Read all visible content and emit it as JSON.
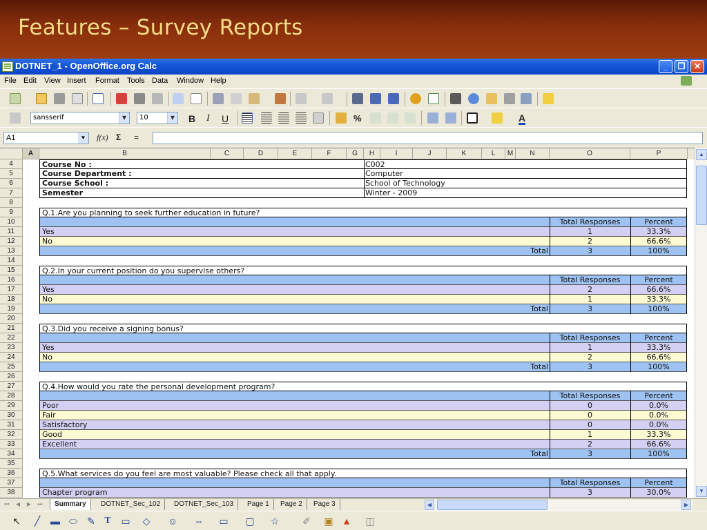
{
  "slide": {
    "title": "Features – Survey Reports"
  },
  "window": {
    "title": "DOTNET_1 - OpenOffice.org Calc"
  },
  "menu": [
    "File",
    "Edit",
    "View",
    "Insert",
    "Format",
    "Tools",
    "Data",
    "Window",
    "Help"
  ],
  "format_toolbar": {
    "font_name": "sansserif",
    "font_size": "10"
  },
  "formula_bar": {
    "cell_ref": "A1",
    "formula": "",
    "func_symbol": "f(x)",
    "sum_symbol": "Σ",
    "equals_symbol": "="
  },
  "columns": [
    "A",
    "B",
    "C",
    "D",
    "E",
    "F",
    "G",
    "H",
    "I",
    "J",
    "K",
    "L",
    "M",
    "N",
    "O",
    "P"
  ],
  "selected_column": "A",
  "rows": [
    {
      "n": "4",
      "type": "info",
      "label": "Course No :",
      "value": "C002"
    },
    {
      "n": "5",
      "type": "info",
      "label": "Course Department :",
      "value": "Computer"
    },
    {
      "n": "6",
      "type": "info",
      "label": "Course School :",
      "value": "School of Technology"
    },
    {
      "n": "7",
      "type": "info",
      "label": "Semester",
      "value": "Winter - 2009"
    },
    {
      "n": "8",
      "type": "blank"
    },
    {
      "n": "9",
      "type": "question",
      "label": "Q.1.Are you planning to seek further education in future?"
    },
    {
      "n": "10",
      "type": "header",
      "resp": "Total Responses",
      "pct": "Percent"
    },
    {
      "n": "11",
      "type": "answer",
      "shade": "purple",
      "label": "Yes",
      "resp": "1",
      "pct": "33.3%"
    },
    {
      "n": "12",
      "type": "answer",
      "shade": "yellow",
      "label": "No",
      "resp": "2",
      "pct": "66.6%"
    },
    {
      "n": "13",
      "type": "total",
      "label": "Total",
      "resp": "3",
      "pct": "100%"
    },
    {
      "n": "14",
      "type": "blank"
    },
    {
      "n": "15",
      "type": "question",
      "label": "Q.2.In your current position do you supervise others?"
    },
    {
      "n": "16",
      "type": "header",
      "resp": "Total Responses",
      "pct": "Percent"
    },
    {
      "n": "17",
      "type": "answer",
      "shade": "purple",
      "label": "Yes",
      "resp": "2",
      "pct": "66.6%"
    },
    {
      "n": "18",
      "type": "answer",
      "shade": "yellow",
      "label": "No",
      "resp": "1",
      "pct": "33.3%"
    },
    {
      "n": "19",
      "type": "total",
      "label": "Total",
      "resp": "3",
      "pct": "100%"
    },
    {
      "n": "20",
      "type": "blank"
    },
    {
      "n": "21",
      "type": "question",
      "label": "Q.3.Did you receive a signing bonus?"
    },
    {
      "n": "22",
      "type": "header",
      "resp": "Total Responses",
      "pct": "Percent"
    },
    {
      "n": "23",
      "type": "answer",
      "shade": "purple",
      "label": "Yes",
      "resp": "1",
      "pct": "33.3%"
    },
    {
      "n": "24",
      "type": "answer",
      "shade": "yellow",
      "label": "No",
      "resp": "2",
      "pct": "66.6%"
    },
    {
      "n": "25",
      "type": "total",
      "label": "Total",
      "resp": "3",
      "pct": "100%"
    },
    {
      "n": "26",
      "type": "blank"
    },
    {
      "n": "27",
      "type": "question",
      "label": "Q.4.How would you rate the personal development program?"
    },
    {
      "n": "28",
      "type": "header",
      "resp": "Total Responses",
      "pct": "Percent"
    },
    {
      "n": "29",
      "type": "answer",
      "shade": "purple",
      "label": "Poor",
      "resp": "0",
      "pct": "0.0%"
    },
    {
      "n": "30",
      "type": "answer",
      "shade": "yellow",
      "label": "Fair",
      "resp": "0",
      "pct": "0.0%"
    },
    {
      "n": "31",
      "type": "answer",
      "shade": "purple",
      "label": "Satisfactory",
      "resp": "0",
      "pct": "0.0%"
    },
    {
      "n": "32",
      "type": "answer",
      "shade": "yellow",
      "label": "Good",
      "resp": "1",
      "pct": "33.3%"
    },
    {
      "n": "33",
      "type": "answer",
      "shade": "purple",
      "label": "Excellent",
      "resp": "2",
      "pct": "66.6%"
    },
    {
      "n": "34",
      "type": "total",
      "label": "Total",
      "resp": "3",
      "pct": "100%"
    },
    {
      "n": "35",
      "type": "blank"
    },
    {
      "n": "36",
      "type": "question",
      "label": "Q.5.What services do you feel are most valuable? Please check all that apply."
    },
    {
      "n": "37",
      "type": "header",
      "resp": "Total Responses",
      "pct": "Percent"
    },
    {
      "n": "38",
      "type": "answer",
      "shade": "purple",
      "label": "Chapter program",
      "resp": "3",
      "pct": "30.0%"
    }
  ],
  "sheet_tabs": [
    "Summary",
    "DOTNET_Sec_102",
    "DOTNET_Sec_103",
    "Page 1",
    "Page 2",
    "Page 3"
  ],
  "active_tab": "Summary"
}
